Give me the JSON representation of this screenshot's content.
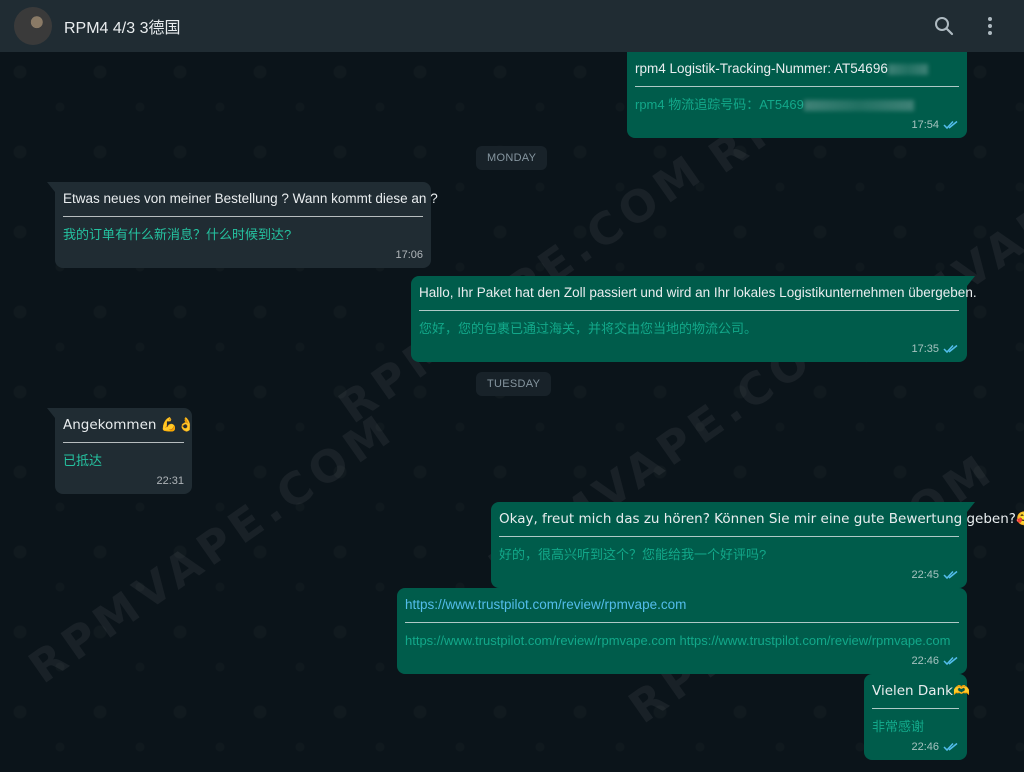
{
  "header": {
    "title": "RPM4    4/3    3德国"
  },
  "watermark_text": "RPMVAPE.COM",
  "date_chips": {
    "monday": "MONDAY",
    "tuesday": "TUESDAY"
  },
  "messages": [
    {
      "direction": "out",
      "original": "rpm4         Logistik-Tracking-Nummer: AT54696",
      "translation": "rpm4         物流追踪号码：AT5469",
      "time": "17:54",
      "status": "read"
    },
    {
      "direction": "in",
      "original": "Etwas neues von meiner Bestellung ? Wann kommt diese an ?",
      "translation": "我的订单有什么新消息？什么时候到达?",
      "time": "17:06"
    },
    {
      "direction": "out",
      "original": "Hallo, Ihr Paket hat den Zoll passiert und wird an Ihr lokales Logistikunternehmen übergeben.",
      "translation": "您好，您的包裹已通过海关，并将交由您当地的物流公司。",
      "time": "17:35",
      "status": "read"
    },
    {
      "direction": "in",
      "original": "Angekommen 💪👌",
      "translation": "已抵达",
      "time": "22:31"
    },
    {
      "direction": "out",
      "original": "Okay, freut mich das zu hören? Können Sie mir eine gute Bewertung geben?🥰",
      "translation": "好的，很高兴听到这个？您能给我一个好评吗?",
      "time": "22:45",
      "status": "read"
    },
    {
      "direction": "out",
      "original": "https://www.trustpilot.com/review/rpmvape.com",
      "translation": "https://www.trustpilot.com/review/rpmvape.com https://www.trustpilot.com/review/rpmvape.com",
      "time": "22:46",
      "status": "read"
    },
    {
      "direction": "out",
      "original": "Vielen Dank🫶",
      "translation": "非常感谢",
      "time": "22:46",
      "status": "read"
    }
  ],
  "colors": {
    "outgoing_bubble": "#005c4b",
    "incoming_bubble": "#202c33",
    "background": "#0b141a",
    "translation_text": "#25c2a0",
    "read_ticks": "#53bdeb"
  },
  "icons": {
    "search": "search-icon",
    "menu": "more-vertical-icon",
    "status": "double-check-icon"
  }
}
